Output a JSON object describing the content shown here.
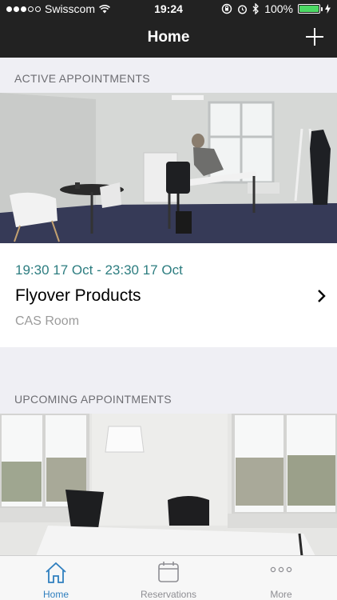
{
  "status_bar": {
    "carrier": "Swisscom",
    "time": "19:24",
    "battery": "100%"
  },
  "nav": {
    "title": "Home",
    "add_icon": "plus-icon"
  },
  "sections": {
    "active_header": "ACTIVE APPOINTMENTS",
    "upcoming_header": "UPCOMING APPOINTMENTS"
  },
  "active_appointment": {
    "time_range": "19:30  17 Oct - 23:30  17 Oct",
    "title": "Flyover Products",
    "room": "CAS Room"
  },
  "tabbar": {
    "items": [
      {
        "label": "Home",
        "icon": "home-icon",
        "active": true
      },
      {
        "label": "Reservations",
        "icon": "calendar-icon",
        "active": false
      },
      {
        "label": "More",
        "icon": "more-icon",
        "active": false
      }
    ]
  },
  "colors": {
    "nav_background": "#222222",
    "accent_time": "#2d7d80",
    "tab_active": "#2f7fbf",
    "tab_inactive": "#8e8e93"
  }
}
